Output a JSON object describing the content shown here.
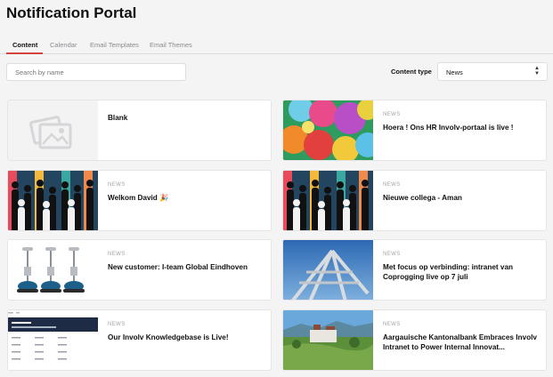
{
  "app": {
    "title": "Notification Portal"
  },
  "tabs": [
    {
      "label": "Content",
      "active": true
    },
    {
      "label": "Calendar"
    },
    {
      "label": "Email Templates"
    },
    {
      "label": "Email Themes"
    }
  ],
  "search": {
    "placeholder": "Search by name"
  },
  "content_type": {
    "label": "Content type",
    "value": "News"
  },
  "cards": [
    {
      "type": "",
      "title": "Blank",
      "thumb_icon": "image-placeholder-icon"
    },
    {
      "type": "NEWS",
      "title": "Hoera ! Ons HR Involv-portaal is live !"
    },
    {
      "type": "NEWS",
      "title": "Welkom David 🎉"
    },
    {
      "type": "NEWS",
      "title": "Nieuwe collega - Aman"
    },
    {
      "type": "NEWS",
      "title": "New customer: I-team Global Eindhoven"
    },
    {
      "type": "NEWS",
      "title": "Met focus op verbinding: intranet van Coprogging live op 7 juli"
    },
    {
      "type": "NEWS",
      "title": "Our Involv Knowledgebase is Live!"
    },
    {
      "type": "NEWS",
      "title": "Aargauische Kantonalbank Embraces Involv Intranet to Power Internal Innovat..."
    }
  ],
  "colors": {
    "accent": "#d6453d"
  }
}
